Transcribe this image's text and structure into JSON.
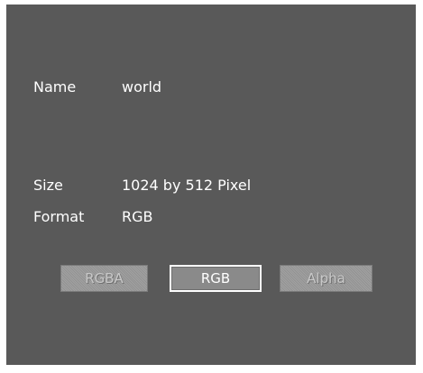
{
  "info": {
    "name_label": "Name",
    "name_value": "world",
    "size_label": "Size",
    "size_value": "1024 by 512 Pixel",
    "format_label": "Format",
    "format_value": "RGB"
  },
  "channels": {
    "rgba_label": "RGBA",
    "rgb_label": "RGB",
    "alpha_label": "Alpha",
    "selected": "RGB"
  },
  "colors": {
    "panel_background": "#595959",
    "text": "#ffffff",
    "disabled_button": "#9b9b9b",
    "active_button": "#8a8a8a"
  }
}
